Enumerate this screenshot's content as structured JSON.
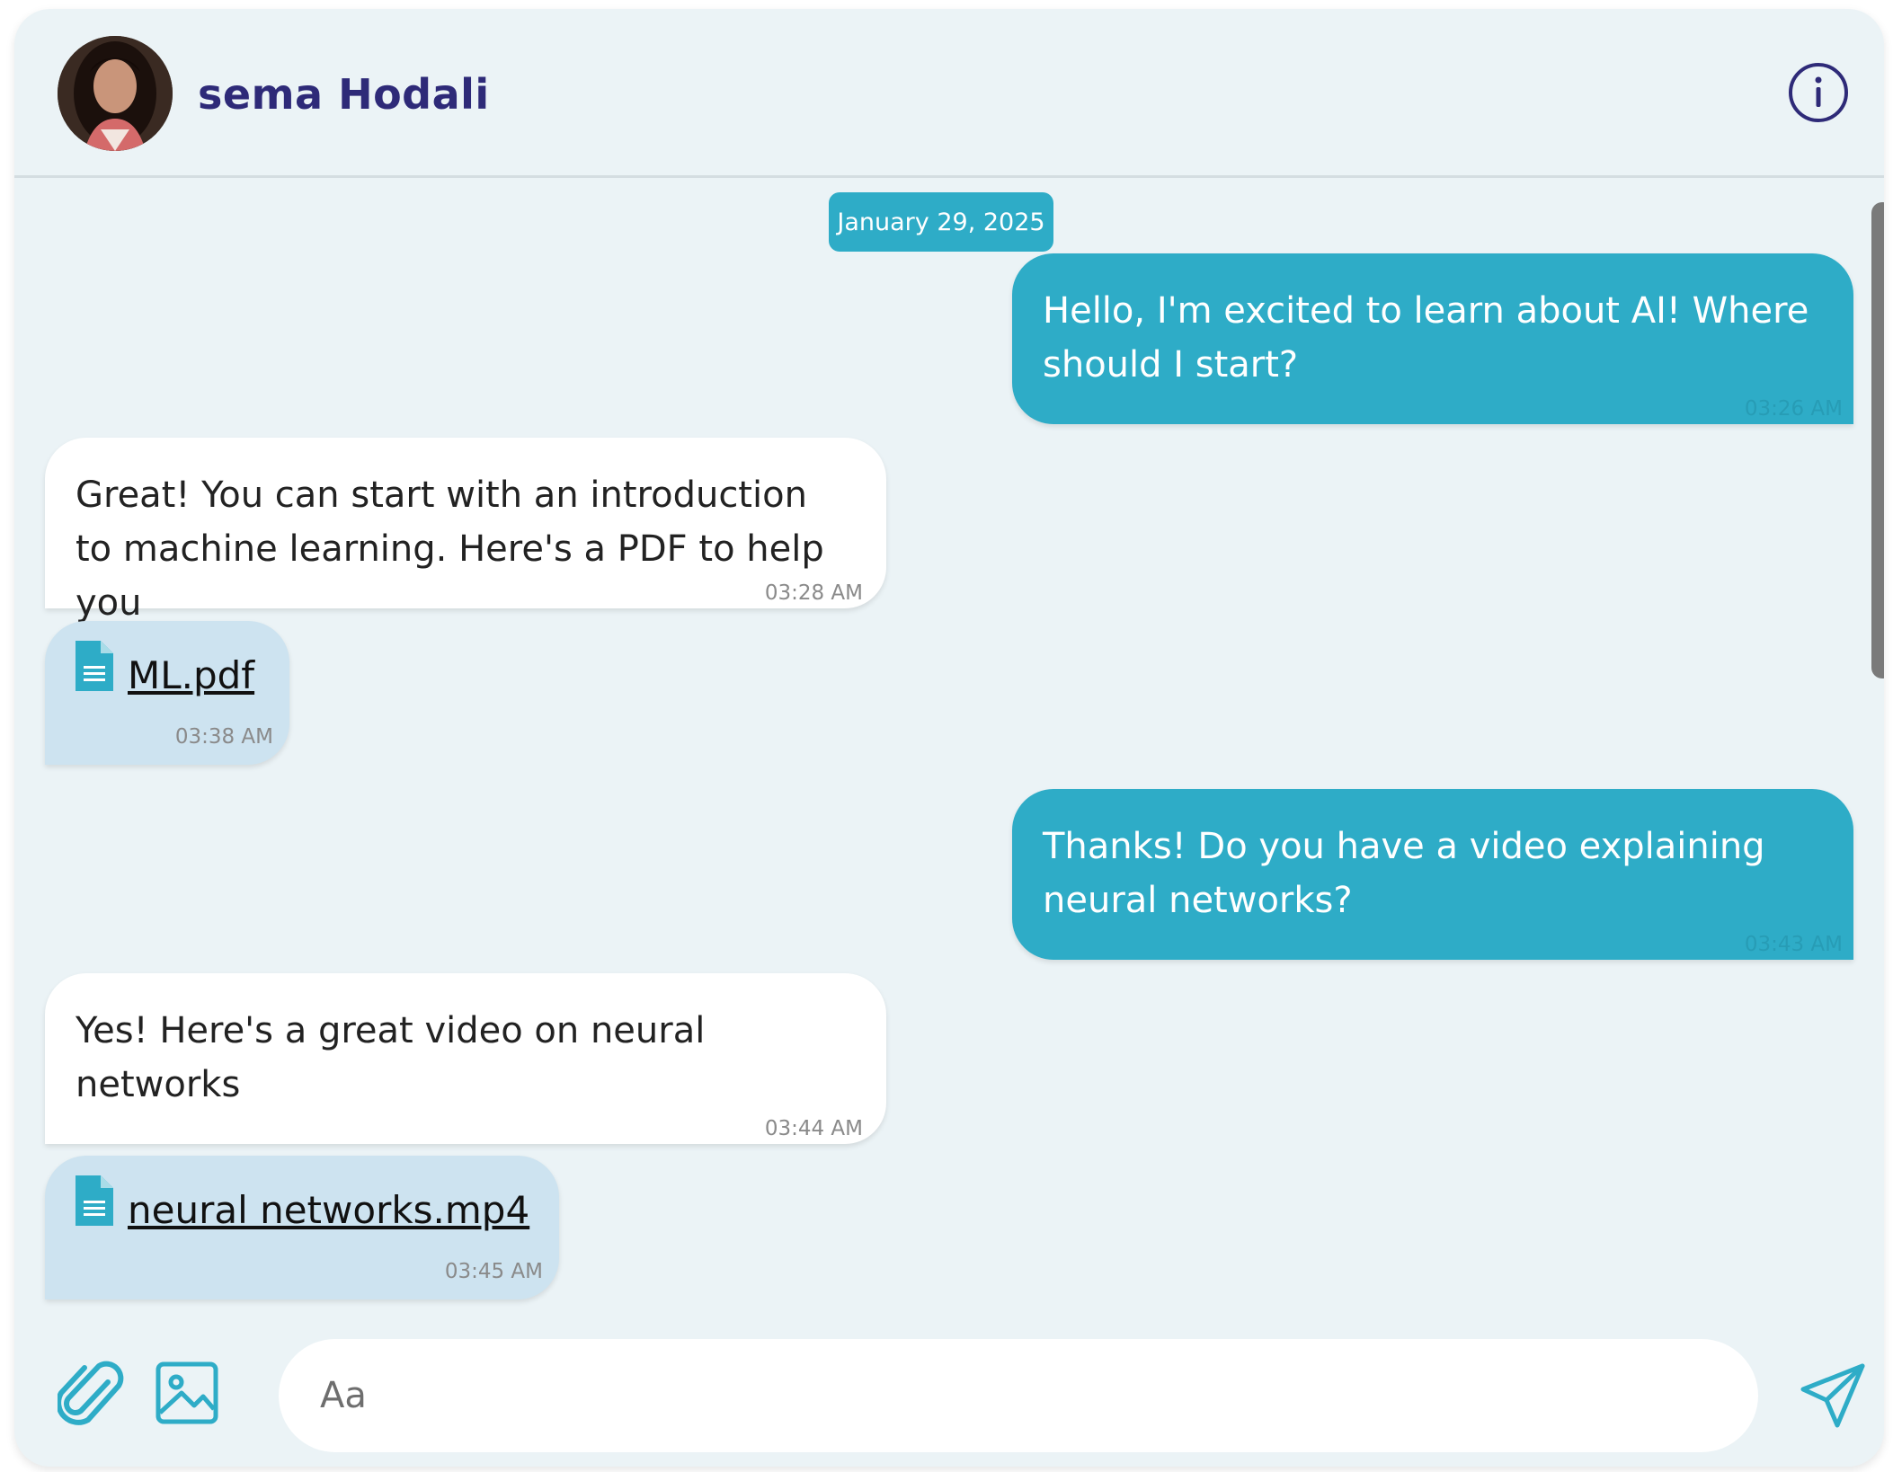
{
  "contact": {
    "name": "sema Hodali"
  },
  "date_divider": "January 29, 2025",
  "messages": [
    {
      "direction": "sent",
      "text": "Hello, I'm excited to learn about AI! Where should I start?",
      "time": "03:26 AM"
    },
    {
      "direction": "received",
      "text": "Great! You can start with an introduction to machine learning. Here's a PDF to help you",
      "time": "03:28 AM"
    },
    {
      "direction": "received",
      "type": "file",
      "filename": "ML.pdf",
      "time": "03:38 AM"
    },
    {
      "direction": "sent",
      "text": "Thanks! Do you have a video explaining neural networks?",
      "time": "03:43 AM"
    },
    {
      "direction": "received",
      "text": "Yes! Here's a great video on neural networks",
      "time": "03:44 AM"
    },
    {
      "direction": "received",
      "type": "file",
      "filename": "neural networks.mp4",
      "time": "03:45 AM"
    }
  ],
  "composer": {
    "placeholder": "Aa",
    "value": ""
  },
  "icons": {
    "info": "info-icon",
    "attach": "paperclip-icon",
    "image": "image-icon",
    "send": "send-icon",
    "file": "document-icon"
  },
  "colors": {
    "background": "#ebf3f6",
    "accent": "#2eacc7",
    "name": "#2e2a78",
    "file_bubble": "#cde3f0",
    "received_bubble": "#ffffff"
  }
}
